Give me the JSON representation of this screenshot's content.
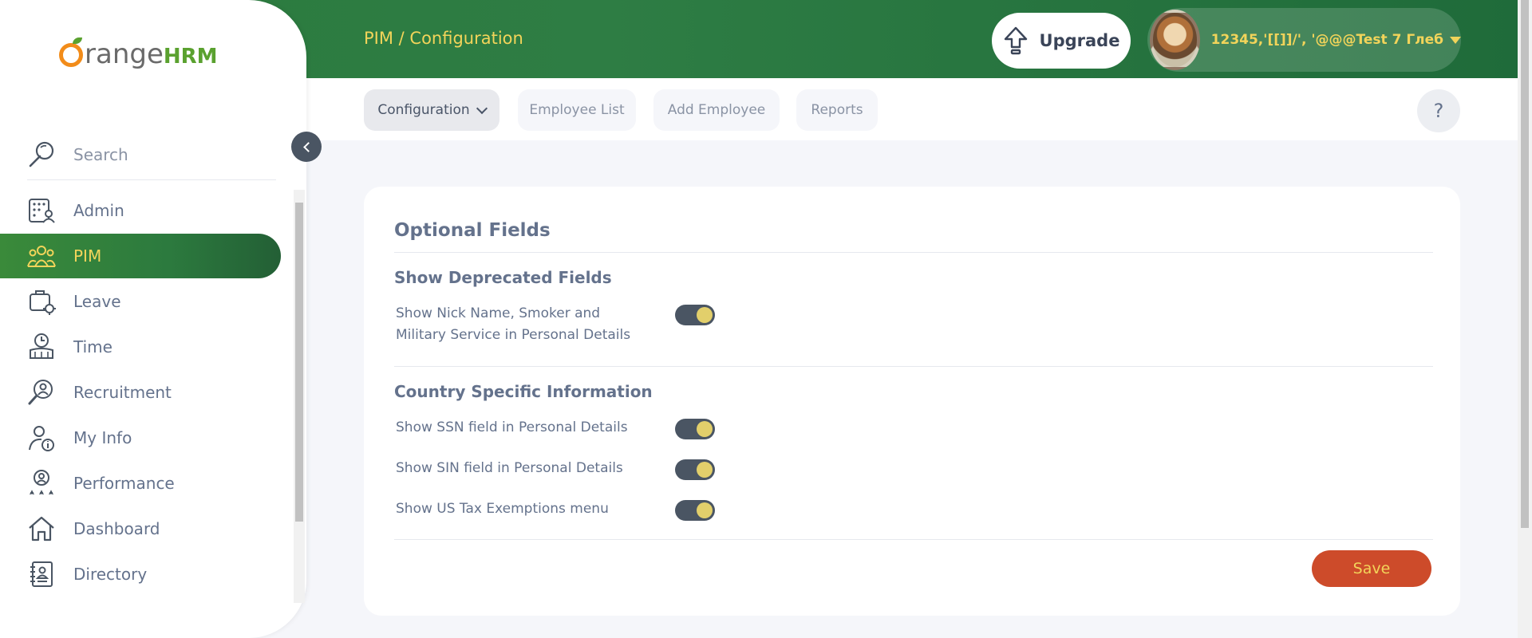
{
  "header": {
    "breadcrumb": "PIM / Configuration",
    "upgrade_label": "Upgrade",
    "user_name": "12345,'[[]]/', '@@@Test 7 Глеб"
  },
  "subnav": {
    "items": [
      {
        "label": "Configuration",
        "active": true
      },
      {
        "label": "Employee List",
        "active": false
      },
      {
        "label": "Add Employee",
        "active": false
      },
      {
        "label": "Reports",
        "active": false
      }
    ],
    "help_label": "?"
  },
  "sidebar": {
    "logo_main": "range",
    "logo_hrm": "HRM",
    "search_label": "Search",
    "items": [
      {
        "label": "Admin",
        "icon": "admin-icon"
      },
      {
        "label": "PIM",
        "icon": "pim-icon",
        "active": true
      },
      {
        "label": "Leave",
        "icon": "leave-icon"
      },
      {
        "label": "Time",
        "icon": "time-icon"
      },
      {
        "label": "Recruitment",
        "icon": "recruitment-icon"
      },
      {
        "label": "My Info",
        "icon": "my-info-icon"
      },
      {
        "label": "Performance",
        "icon": "performance-icon"
      },
      {
        "label": "Dashboard",
        "icon": "dashboard-icon"
      },
      {
        "label": "Directory",
        "icon": "directory-icon"
      }
    ]
  },
  "main": {
    "title": "Optional Fields",
    "sections": [
      {
        "title": "Show Deprecated Fields",
        "fields": [
          {
            "label": "Show Nick Name, Smoker and Military Service in Personal Details",
            "enabled": true
          }
        ]
      },
      {
        "title": "Country Specific Information",
        "fields": [
          {
            "label": "Show SSN field in Personal Details",
            "enabled": true
          },
          {
            "label": "Show SIN field in Personal Details",
            "enabled": true
          },
          {
            "label": "Show US Tax Exemptions menu",
            "enabled": true
          }
        ]
      }
    ],
    "save_label": "Save"
  },
  "colors": {
    "header_green": "#2e7d44",
    "accent_yellow": "#f2d45a",
    "save_orange": "#cd4b2a",
    "toggle_dark": "#4a5563"
  }
}
